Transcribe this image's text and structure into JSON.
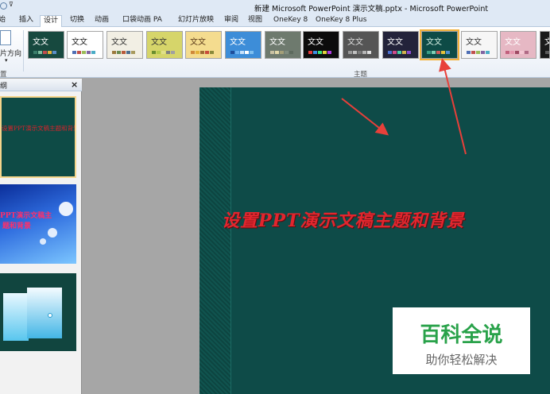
{
  "window": {
    "title": "新建 Microsoft PowerPoint 演示文稿.pptx - Microsoft PowerPoint",
    "qat_more": "⊽"
  },
  "tabs": [
    {
      "label": "始"
    },
    {
      "label": "插入"
    },
    {
      "label": "设计",
      "active": true
    },
    {
      "label": "切换"
    },
    {
      "label": "动画"
    },
    {
      "label": "口袋动画 PA"
    },
    {
      "label": "幻灯片放映"
    },
    {
      "label": "审阅"
    },
    {
      "label": "视图"
    },
    {
      "label": "OneKey 8"
    },
    {
      "label": "OneKey 8 Plus"
    }
  ],
  "ribbon": {
    "orientation_label": "片方向",
    "orientation_arrow": "▾",
    "group_left_label": "置",
    "themes_group_label": "主题",
    "themes": [
      {
        "label": "文文",
        "bg": "#17493f",
        "text": "#ffffff",
        "bars": [
          "#3b7d6a",
          "#7fbf9f",
          "#c24d4d",
          "#e4b23a",
          "#5b8ec7"
        ],
        "selected": false
      },
      {
        "label": "文文",
        "bg": "#ffffff",
        "text": "#222222",
        "bars": [
          "#4f6fb5",
          "#c0504d",
          "#9bbb59",
          "#8064a2",
          "#4bacc6"
        ],
        "selected": false
      },
      {
        "label": "文文",
        "bg": "#f2efe4",
        "text": "#333333",
        "bars": [
          "#9c7a3c",
          "#6a8b4f",
          "#b85b3b",
          "#4e6e8e",
          "#a89a5e"
        ],
        "selected": false
      },
      {
        "label": "文文",
        "bg": "#d6d56a",
        "text": "#333333",
        "bars": [
          "#6a8e2f",
          "#b3c94a",
          "#e0e08a",
          "#808080",
          "#a0a0a0"
        ],
        "selected": false
      },
      {
        "label": "文文",
        "bg": "#f4dc8f",
        "text": "#5a3a1a",
        "bars": [
          "#d0883a",
          "#e4b23a",
          "#9e6b34",
          "#c94b3b",
          "#8a8a3a"
        ],
        "selected": false
      },
      {
        "label": "文文",
        "bg": "#3d8dd8",
        "text": "#ffffff",
        "bars": [
          "#1f4e9a",
          "#6cb0ef",
          "#c7e1fa",
          "#ffffff",
          "#7fbfef"
        ],
        "selected": false
      },
      {
        "label": "文文",
        "bg": "#6e7a6e",
        "text": "#ffffff",
        "bars": [
          "#c9c1a3",
          "#e2d7a8",
          "#a49f78",
          "#808c7e",
          "#5d6a5d"
        ],
        "selected": false
      },
      {
        "label": "文文",
        "bg": "#0c0c0c",
        "text": "#ffffff",
        "bars": [
          "#e23b3b",
          "#3b8fe2",
          "#3be27a",
          "#e2d13b",
          "#b03be2"
        ],
        "selected": false
      },
      {
        "label": "文文",
        "bg": "#555555",
        "text": "#dddddd",
        "bars": [
          "#9a9a9a",
          "#c0c0c0",
          "#7a7a7a",
          "#b7b7b7",
          "#e0e0e0"
        ],
        "selected": false
      },
      {
        "label": "文文",
        "bg": "#23233a",
        "text": "#ffffff",
        "bars": [
          "#4b6fd0",
          "#d04b8a",
          "#4bd0a8",
          "#d0b24b",
          "#8a4bd0"
        ],
        "selected": false
      },
      {
        "label": "文文",
        "bg": "#0e4b46",
        "text": "#d4f0e4",
        "bars": [
          "#3a9d86",
          "#7fcfb4",
          "#cf5a5a",
          "#e4c23a",
          "#4f8fcf"
        ],
        "selected": true
      },
      {
        "label": "文文",
        "bg": "#f6f6f6",
        "text": "#333333",
        "bars": [
          "#4f6fb5",
          "#c0504d",
          "#9bbb59",
          "#8064a2",
          "#4bacc6"
        ],
        "selected": false
      },
      {
        "label": "文文",
        "bg": "#e6b8c4",
        "text": "#ffffff",
        "bars": [
          "#c2607d",
          "#e495ad",
          "#9e4a64",
          "#f3c7d3",
          "#b06b86"
        ],
        "selected": false
      },
      {
        "label": "文文",
        "bg": "#1a1a1a",
        "text": "#ffffff",
        "bars": [
          "#5a5a5a",
          "#7a7a7a",
          "#9a9a9a",
          "#bababa",
          "#dadada"
        ],
        "selected": false
      }
    ]
  },
  "panel": {
    "tab_label": "纲",
    "close_label": "×",
    "slides": [
      {
        "text": "设置PPT演示文稿主题和背景"
      },
      {
        "text_line1": "PPT演示文稿主",
        "text_line2": "题和背景"
      },
      {
        "text": ""
      }
    ]
  },
  "slide": {
    "title": "设置PPT演示文稿主题和背景",
    "background": "#0e4b48",
    "title_color": "#e2262e"
  },
  "watermark": {
    "title": "百科全说",
    "subtitle": "助你轻松解决",
    "title_color": "#29a24a"
  },
  "annotation": {
    "arrow_color": "#e8403a"
  }
}
